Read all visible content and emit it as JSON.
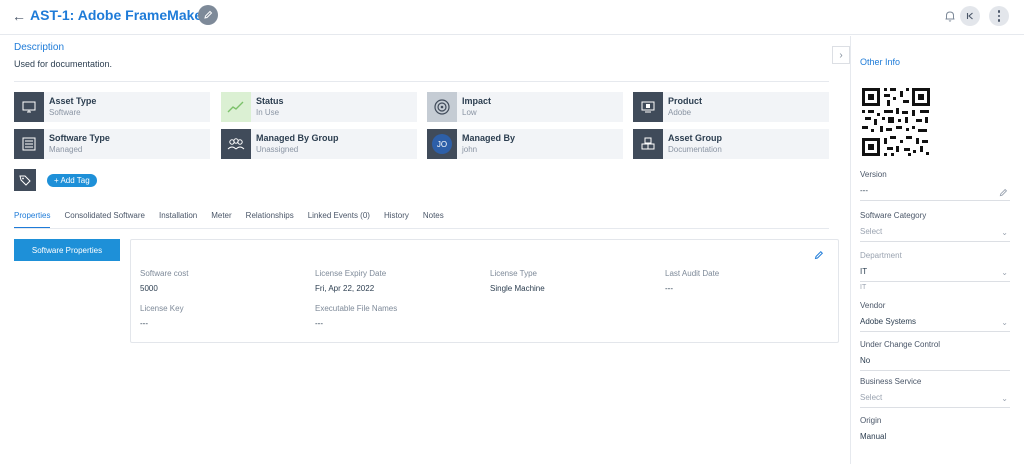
{
  "header": {
    "back_glyph": "←",
    "title": "AST-1: Adobe FrameMaker",
    "icons": [
      "pencil-icon",
      "bell-icon",
      "collapse-icon",
      "more-icon"
    ]
  },
  "description": {
    "label": "Description",
    "text": "Used for documentation."
  },
  "cards": [
    {
      "label": "Asset Type",
      "value": "Software",
      "icon": "monitor-icon"
    },
    {
      "label": "Status",
      "value": "In Use",
      "icon": "trend-icon"
    },
    {
      "label": "Impact",
      "value": "Low",
      "icon": "target-icon"
    },
    {
      "label": "Product",
      "value": "Adobe",
      "icon": "product-icon"
    },
    {
      "label": "Software Type",
      "value": "Managed",
      "icon": "list-icon"
    },
    {
      "label": "Managed By Group",
      "value": "Unassigned",
      "icon": "group-icon"
    },
    {
      "label": "Managed By",
      "value": "john",
      "avatar": "JO"
    },
    {
      "label": "Asset Group",
      "value": "Documentation",
      "icon": "boxes-icon"
    }
  ],
  "tags": {
    "add_label": "+ Add Tag"
  },
  "tabs": [
    {
      "label": "Properties",
      "active": true
    },
    {
      "label": "Consolidated Software"
    },
    {
      "label": "Installation"
    },
    {
      "label": "Meter"
    },
    {
      "label": "Relationships"
    },
    {
      "label": "Linked Events (0)"
    },
    {
      "label": "History"
    },
    {
      "label": "Notes"
    }
  ],
  "properties": {
    "section_button": "Software Properties",
    "fields": [
      {
        "label": "Software cost",
        "value": "5000"
      },
      {
        "label": "License Expiry Date",
        "value": "Fri, Apr 22, 2022"
      },
      {
        "label": "License Type",
        "value": "Single Machine"
      },
      {
        "label": "Last Audit Date",
        "value": "---"
      },
      {
        "label": "License Key",
        "value": "---"
      },
      {
        "label": "Executable File Names",
        "value": "---"
      }
    ]
  },
  "sidebar": {
    "title": "Other Info",
    "fields": [
      {
        "label": "Version",
        "value": "---"
      },
      {
        "label": "Software Category",
        "value": "Select"
      },
      {
        "label": "Department",
        "value": "IT",
        "sub": "IT"
      },
      {
        "label": "Vendor",
        "value": "Adobe Systems"
      },
      {
        "label": "Under Change Control",
        "value": "No"
      },
      {
        "label": "Business Service",
        "value": "Select"
      },
      {
        "label": "Origin",
        "value": "Manual"
      }
    ]
  },
  "colors": {
    "accent": "#1e7bd8",
    "button": "#1e90d8",
    "icon_bg": "#404b5a",
    "card_bg": "#f2f4f7"
  }
}
